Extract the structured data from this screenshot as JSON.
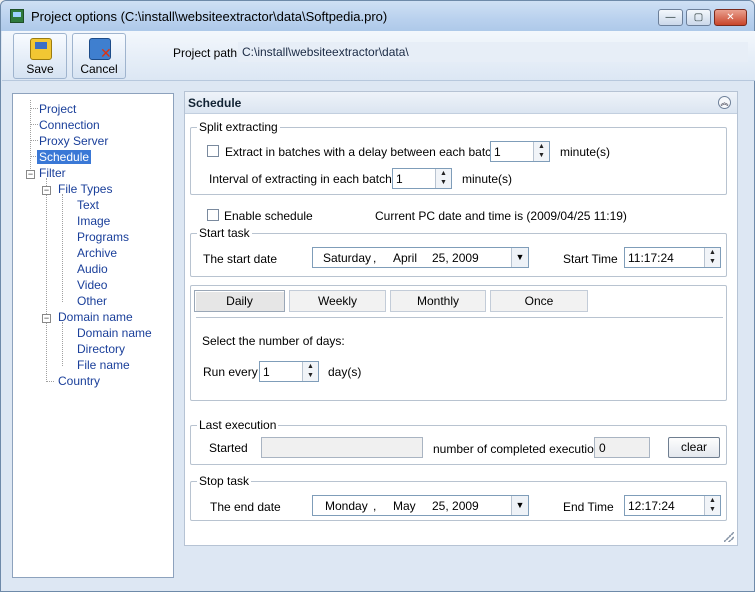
{
  "window": {
    "title": "Project options (C:\\install\\websiteextractor\\data\\Softpedia.pro)",
    "controls": {
      "minimize": "—",
      "maximize": "▢",
      "close": "✕"
    }
  },
  "toolbar": {
    "save_label": "Save",
    "cancel_label": "Cancel",
    "project_path_label": "Project path",
    "project_path_value": "C:\\install\\websiteextractor\\data\\"
  },
  "tree": {
    "items": [
      {
        "label": "Project"
      },
      {
        "label": "Connection"
      },
      {
        "label": "Proxy Server"
      },
      {
        "label": "Schedule"
      },
      {
        "label": "Filter"
      },
      {
        "label": "File Types"
      },
      {
        "label": "Text"
      },
      {
        "label": "Image"
      },
      {
        "label": "Programs"
      },
      {
        "label": "Archive"
      },
      {
        "label": "Audio"
      },
      {
        "label": "Video"
      },
      {
        "label": "Other"
      },
      {
        "label": "Domain name"
      },
      {
        "label": "Domain name"
      },
      {
        "label": "Directory"
      },
      {
        "label": "File name"
      },
      {
        "label": "Country"
      }
    ],
    "selected": "Schedule",
    "expander_minus": "−"
  },
  "schedule": {
    "title": "Schedule",
    "collapse_icon": "︽",
    "split": {
      "legend": "Split extracting",
      "extract_batches_label": "Extract in batches with a delay between each batch =",
      "batch_delay_value": "1",
      "batch_delay_unit": "minute(s)",
      "interval_label": "Interval of extracting in each batch",
      "interval_value": "1",
      "interval_unit": "minute(s)"
    },
    "enable_schedule_label": "Enable schedule",
    "current_time_text": "Current PC date and time is (2009/04/25 11:19)",
    "start_task": {
      "legend": "Start task",
      "start_date_label": "The start date",
      "date_weekday": "Saturday",
      "date_month": "April",
      "date_daysep": ",",
      "date_day_year": "25, 2009",
      "start_time_label": "Start Time",
      "start_time_value": "11:17:24"
    },
    "tabs": [
      "Daily",
      "Weekly",
      "Monthly",
      "Once"
    ],
    "daily": {
      "select_days_label": "Select the number of days:",
      "run_every_label": "Run every",
      "run_every_value": "1",
      "run_every_unit": "day(s)"
    },
    "last_execution": {
      "legend": "Last execution",
      "started_label": "Started",
      "started_value": "",
      "completed_label": "number of completed executions",
      "completed_value": "0",
      "clear_label": "clear"
    },
    "stop_task": {
      "legend": "Stop task",
      "end_date_label": "The end date",
      "date_weekday": "Monday",
      "date_month": "May",
      "date_daysep": ",",
      "date_day_year": "25, 2009",
      "end_time_label": "End Time",
      "end_time_value": "12:17:24"
    }
  },
  "colors": {
    "selection": "#3a78d6",
    "tree_link": "#1a3f9a",
    "window_frame": "#dde7f3"
  }
}
